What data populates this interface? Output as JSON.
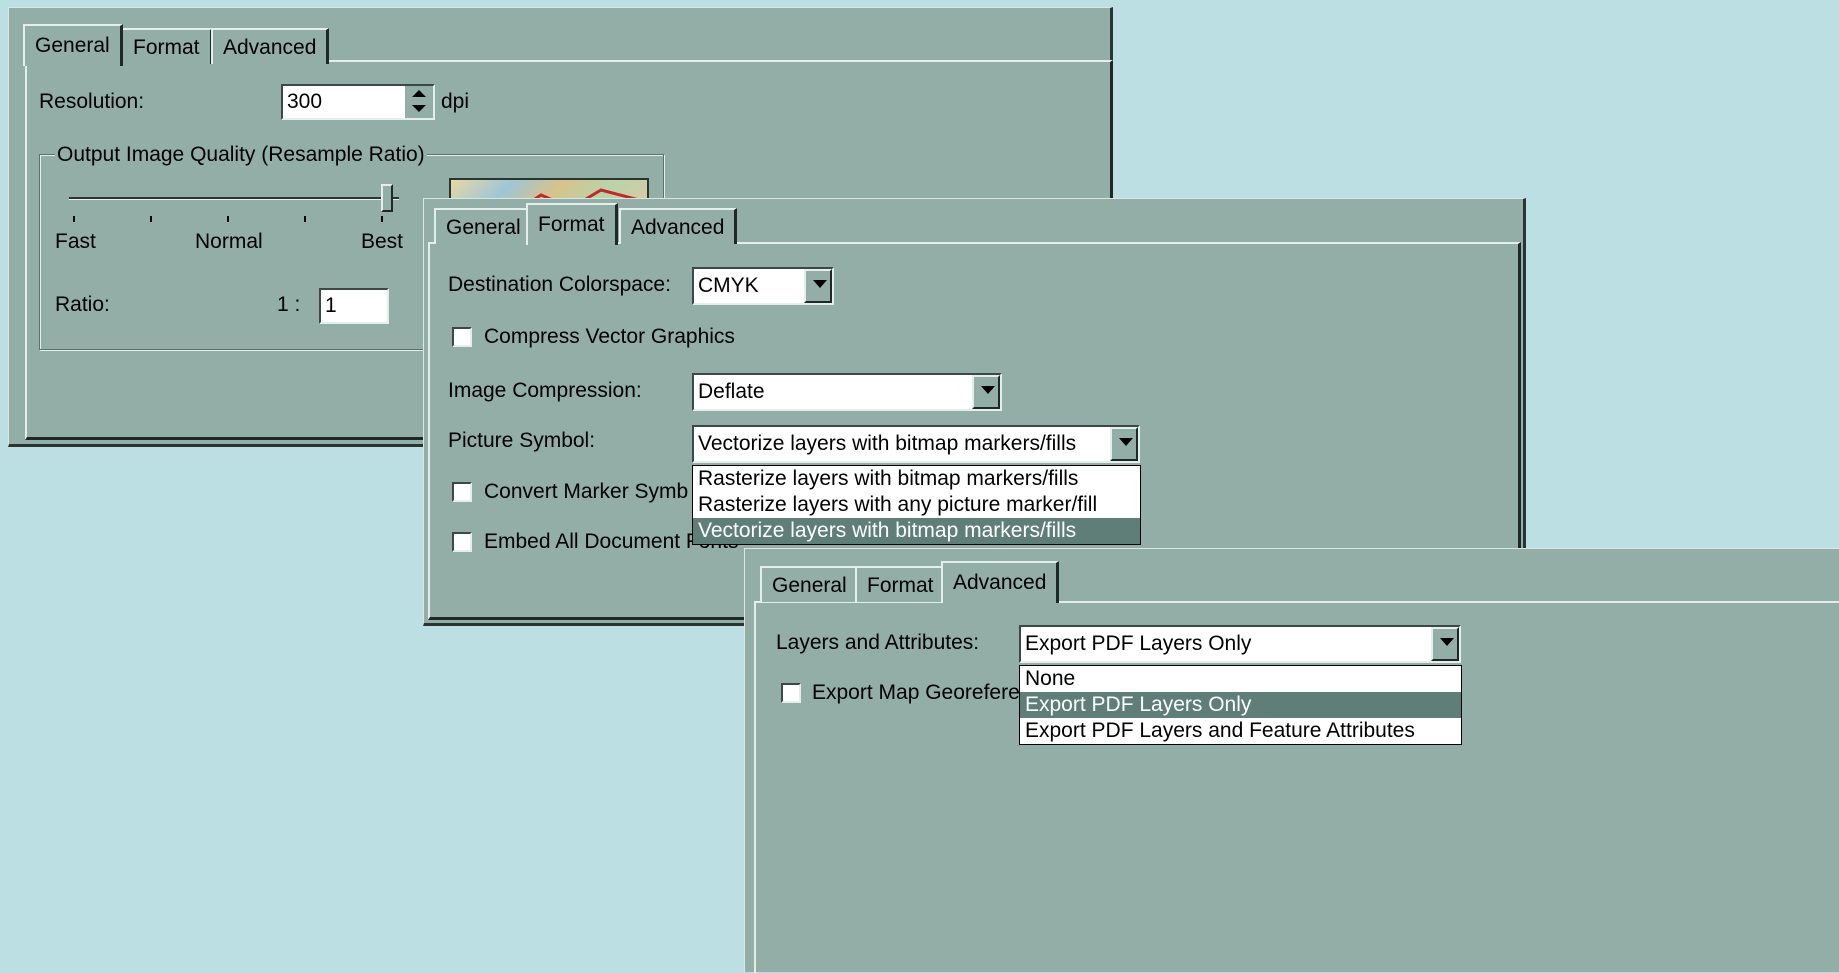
{
  "general": {
    "tabs": [
      "General",
      "Format",
      "Advanced"
    ],
    "resolution_label": "Resolution:",
    "resolution_value": "300",
    "resolution_unit": "dpi",
    "group_title": "Output Image Quality (Resample Ratio)",
    "slider_labels": [
      "Fast",
      "Normal",
      "Best"
    ],
    "slider_level": 1.0,
    "ratio_label": "Ratio:",
    "ratio_prefix": "1 :",
    "ratio_value": "1"
  },
  "format": {
    "tabs": [
      "General",
      "Format",
      "Advanced"
    ],
    "colorspace_label": "Destination Colorspace:",
    "colorspace_value": "CMYK",
    "compress_label": "Compress Vector Graphics",
    "compression_label": "Image Compression:",
    "compression_value": "Deflate",
    "picture_label": "Picture Symbol:",
    "picture_value": "Vectorize layers with bitmap markers/fills",
    "picture_options": [
      "Rasterize layers with bitmap markers/fills",
      "Rasterize layers with any picture marker/fill",
      "Vectorize layers with bitmap markers/fills"
    ],
    "picture_selected_index": 2,
    "convert_label": "Convert Marker Symb",
    "embed_label": "Embed All Document Fonts"
  },
  "advanced": {
    "tabs": [
      "General",
      "Format",
      "Advanced"
    ],
    "layers_label": "Layers and Attributes:",
    "layers_value": "Export PDF Layers Only",
    "layers_options": [
      "None",
      "Export PDF Layers Only",
      "Export PDF Layers and Feature Attributes"
    ],
    "layers_selected_index": 1,
    "georef_label": "Export Map Georefere"
  },
  "colors": {
    "background": "#bcdfe3",
    "panel": "#92aea6",
    "selection": "#5e7e77"
  }
}
